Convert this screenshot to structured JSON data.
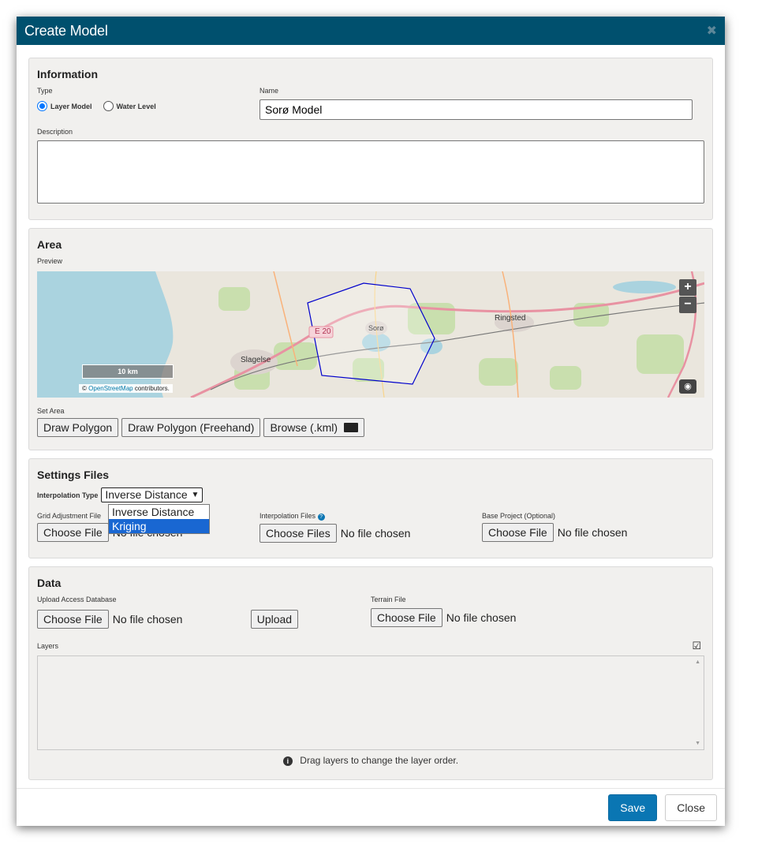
{
  "modal": {
    "title": "Create Model"
  },
  "information": {
    "heading": "Information",
    "type_label": "Type",
    "type_options": [
      "Layer Model",
      "Water Level"
    ],
    "type_selected": "Layer Model",
    "name_label": "Name",
    "name_value": "Sorø Model",
    "description_label": "Description",
    "description_value": ""
  },
  "area": {
    "heading": "Area",
    "preview_label": "Preview",
    "map": {
      "places": [
        "Ringsted",
        "Sorø",
        "Slagelse"
      ],
      "road_label": "E 20",
      "scale_label": "10 km",
      "attribution_prefix": "©",
      "attribution_link": "OpenStreetMap",
      "attribution_suffix": "contributors.",
      "zoom_in": "+",
      "zoom_out": "−"
    },
    "set_area_label": "Set Area",
    "buttons": [
      "Draw Polygon",
      "Draw Polygon (Freehand)",
      "Browse (.kml)"
    ]
  },
  "settings": {
    "heading": "Settings Files",
    "interp_type_label": "Interpolation Type",
    "interp_type_value": "Inverse Distance",
    "interp_options": [
      "Inverse Distance",
      "Kriging"
    ],
    "interp_highlighted": "Kriging",
    "grid_label": "Grid Adjustment File",
    "interp_files_label": "Interpolation Files",
    "base_project_label": "Base Project (Optional)",
    "choose_file": "Choose File",
    "choose_files": "Choose Files",
    "no_file": "No file chosen"
  },
  "data": {
    "heading": "Data",
    "upload_db_label": "Upload Access Database",
    "terrain_label": "Terrain File",
    "upload_button": "Upload",
    "layers_label": "Layers",
    "hint": "Drag layers to change the layer order.",
    "choose_file": "Choose File",
    "no_file": "No file chosen"
  },
  "footer": {
    "save": "Save",
    "close": "Close"
  },
  "colors": {
    "header": "#00506e",
    "save": "#0a76b3",
    "highlight": "#1967d2",
    "polygon": "#0000cc"
  }
}
